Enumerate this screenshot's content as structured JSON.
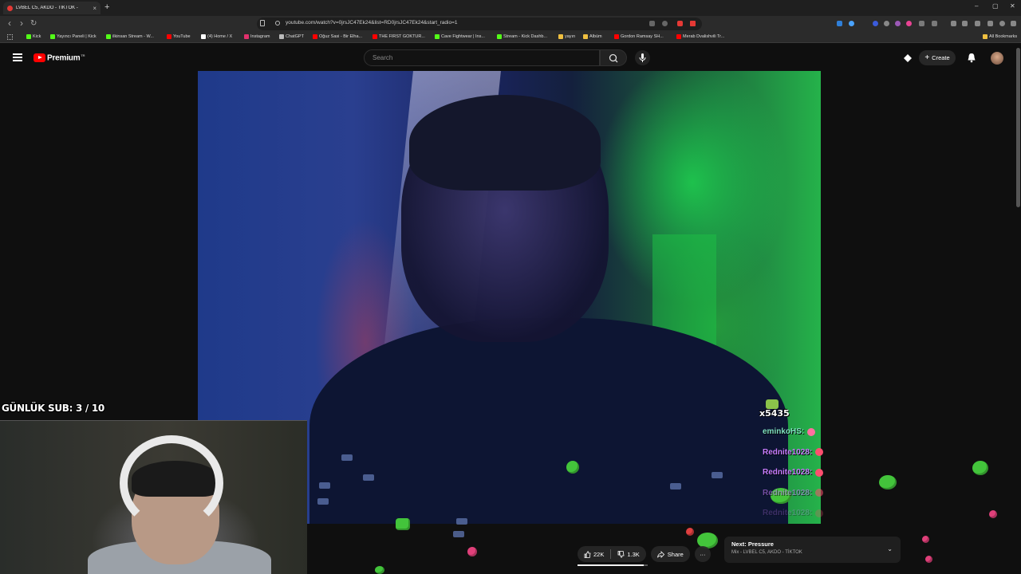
{
  "browser": {
    "tab_title": "LVBEL C5, AKDO - TIKTOK -",
    "tab_close": "×",
    "new_tab": "+",
    "url": "youtube.com/watch?v=0jrsJC47Ek24&list=RD0jrsJC47Ek24&start_radio=1",
    "window_controls": [
      "–",
      "▢",
      "✕"
    ],
    "nav": {
      "back": "‹",
      "forward": "›",
      "reload": "↻"
    },
    "bookmarks": [
      {
        "label": "Kick",
        "color": "#53fc18"
      },
      {
        "label": "Yayıncı Paneli | Kick",
        "color": "#53fc18"
      },
      {
        "label": "ilkinsan Stream - W...",
        "color": "#53fc18"
      },
      {
        "label": "YouTube",
        "color": "#ff0000"
      },
      {
        "label": "(4) Home / X",
        "color": "#ffffff"
      },
      {
        "label": "Instagram",
        "color": "#e1306c"
      },
      {
        "label": "ChatGPT",
        "color": "#bbbbbb"
      },
      {
        "label": "Oğuz Sasi - Bir Elha...",
        "color": "#ff0000"
      },
      {
        "label": "THE FIRST GOKTUR...",
        "color": "#ff0000"
      },
      {
        "label": "Cave Fightwear | Ins...",
        "color": "#53fc18"
      },
      {
        "label": "Stream - Kick Dashb...",
        "color": "#53fc18"
      },
      {
        "label": "yayın",
        "color": "#f0c040"
      },
      {
        "label": "Albüm",
        "color": "#f0c040"
      },
      {
        "label": "Gordon Ramsay SH...",
        "color": "#ff0000"
      },
      {
        "label": "Merab Dvalishvili Tr...",
        "color": "#ff0000"
      }
    ],
    "all_bookmarks": "All Bookmarks"
  },
  "youtube": {
    "brand": "Premium",
    "brand_sup": "TR",
    "search_placeholder": "Search",
    "create_label": "Create"
  },
  "overlay": {
    "sub_goal": "GÜNLÜK SUB: 3 / 10",
    "combo": "x5435",
    "chat": [
      {
        "user": "eminkoHS:",
        "color": "#7fe0c0",
        "emote_color": "#ff6fa0"
      },
      {
        "user": "Rednite1028:",
        "color": "#c77dff",
        "emote_color": "#ff4f6f"
      },
      {
        "user": "Rednite1028:",
        "color": "#c77dff",
        "emote_color": "#ff4f6f"
      },
      {
        "user": "Rednite1028:",
        "color": "#c77dff",
        "emote_color": "#ff4f6f"
      },
      {
        "user": "Rednite1028:",
        "color": "#c77dff",
        "emote_color": "#ff4f6f"
      }
    ]
  },
  "player": {
    "likes": "22K",
    "dislikes": "1.3K",
    "share": "Share",
    "more": "···",
    "like_ratio": 0.94,
    "next_title": "Next: Pressure",
    "next_sub": "Mix - LVBEL C5, AKDO - TİKTOK"
  }
}
